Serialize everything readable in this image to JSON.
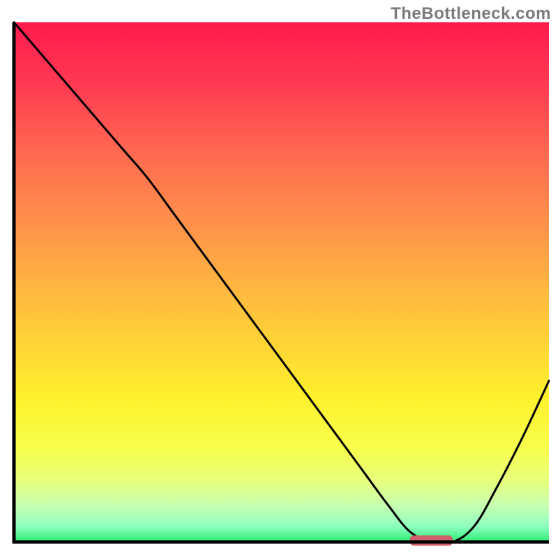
{
  "watermark": "TheBottleneck.com",
  "chart_data": {
    "type": "line",
    "title": "",
    "xlabel": "",
    "ylabel": "",
    "xlim": [
      0,
      100
    ],
    "ylim": [
      0,
      100
    ],
    "x": [
      0,
      5,
      10,
      15,
      20,
      25,
      30,
      35,
      40,
      45,
      50,
      55,
      60,
      65,
      70,
      74,
      78,
      82,
      86,
      90,
      95,
      100
    ],
    "values": [
      100,
      94,
      88,
      82,
      76,
      70,
      63,
      56,
      49,
      42,
      35,
      28,
      21,
      14,
      7,
      2,
      0,
      0,
      3,
      10,
      20,
      31
    ],
    "axes": {
      "left_visible": true,
      "bottom_visible": true,
      "ticks_visible": false,
      "grid_visible": false
    },
    "gradient_stops": [
      {
        "offset": 0.0,
        "color": "#ff1a4d"
      },
      {
        "offset": 0.12,
        "color": "#ff3a52"
      },
      {
        "offset": 0.25,
        "color": "#ff6950"
      },
      {
        "offset": 0.38,
        "color": "#ff8f4b"
      },
      {
        "offset": 0.5,
        "color": "#ffb341"
      },
      {
        "offset": 0.62,
        "color": "#ffd535"
      },
      {
        "offset": 0.72,
        "color": "#fff02c"
      },
      {
        "offset": 0.82,
        "color": "#f7ff4d"
      },
      {
        "offset": 0.88,
        "color": "#e8ff7a"
      },
      {
        "offset": 0.93,
        "color": "#c7ffb0"
      },
      {
        "offset": 0.97,
        "color": "#8effc0"
      },
      {
        "offset": 1.0,
        "color": "#2bec71"
      }
    ],
    "marker": {
      "x": 78,
      "y": 0,
      "width": 8,
      "height": 2,
      "color": "#cf5f6b"
    },
    "inner_x": 20,
    "inner_y": 32,
    "inner_w": 767,
    "inner_h": 745
  }
}
